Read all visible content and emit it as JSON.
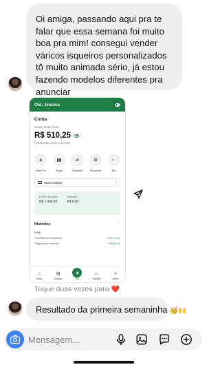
{
  "messages": {
    "first": "Oi amiga, passando aqui pra te falar que essa semana foi muito boa pra mim! consegui vender váricos isqueiros personalizados tô muito animada sério, já estou fazendo modelos diferentes pra anunciar",
    "second_text": "Resultado da primeira semaninha",
    "second_emojis": "🥳🙌"
  },
  "reaction": {
    "text": "Toque duas vezes para",
    "emoji": "❤️"
  },
  "shared_screenshot": {
    "greeting": "Olá, Jéssica",
    "section_title": "Conta",
    "balance_label": "Saldo disponível",
    "balance_value": "R$ 510,25",
    "yield_text": "Rendendo 102% do CDI",
    "actions": [
      {
        "label": "Área Pix",
        "icon": "pix-icon",
        "glyph": "◈"
      },
      {
        "label": "Pagar",
        "icon": "barcode-icon",
        "glyph": "▮▮"
      },
      {
        "label": "Transferir",
        "icon": "transfer-icon",
        "glyph": "⇄"
      },
      {
        "label": "Depositar",
        "icon": "deposit-icon",
        "glyph": "⊞"
      },
      {
        "label": "Ma",
        "icon": "more-icon",
        "glyph": "⋯"
      }
    ],
    "cards_label": "Meus cartões",
    "limit_label": "Limite da conta",
    "limit_value": "R$ 1.000,00",
    "used_label": "Utilizado",
    "used_value": "R$ 0,00",
    "history_title": "Histórico",
    "history_day": "Hoje",
    "history": [
      {
        "description": "Transferência recebida",
        "amount": "+ R$ 170,00"
      },
      {
        "description": "Pagamento recebido",
        "amount": "+ R$ 85,00"
      }
    ],
    "tabs": [
      {
        "label": "Início",
        "icon": "home-icon",
        "glyph": "⌂"
      },
      {
        "label": "Extrato",
        "icon": "statement-icon",
        "glyph": "▤"
      },
      {
        "label": "Pix",
        "icon": "pix-icon",
        "glyph": "◈"
      },
      {
        "label": "Cartões",
        "icon": "card-icon",
        "glyph": "▭"
      },
      {
        "label": "Menu",
        "icon": "menu-icon",
        "glyph": "≡"
      }
    ]
  },
  "composer": {
    "placeholder": "Mensagem..."
  },
  "colors": {
    "bank_green": "#1e7d45",
    "camera_blue": "#3b82f6",
    "bubble_gray": "#efefef"
  }
}
